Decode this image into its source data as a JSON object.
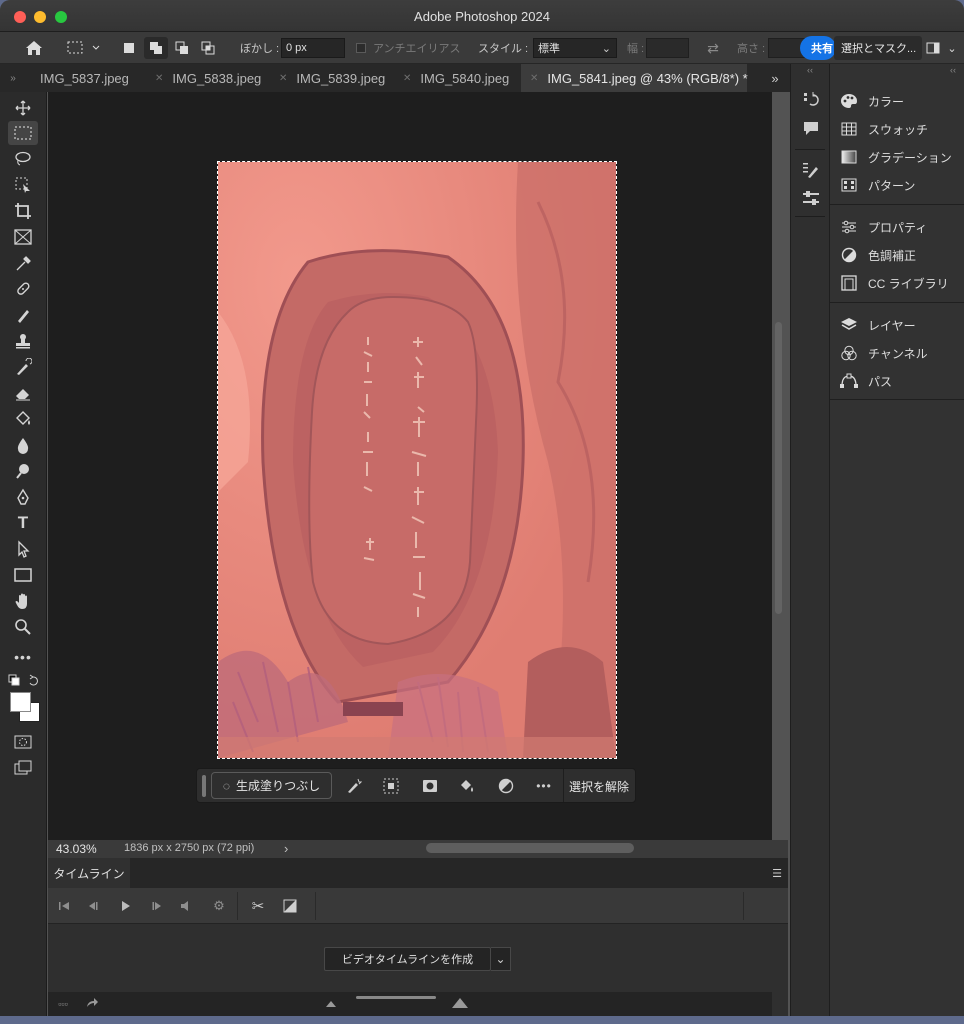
{
  "app": {
    "title": "Adobe Photoshop 2024"
  },
  "options_bar": {
    "feather_label": "ぼかし :",
    "feather_value": "0 px",
    "antialias_label": "アンチエイリアス",
    "style_label": "スタイル :",
    "style_value": "標準",
    "width_label": "幅 :",
    "height_label": "高さ :",
    "share_label": "共有",
    "select_mask_label": "選択とマスク..."
  },
  "tabs": [
    {
      "label": "IMG_5837.jpeg"
    },
    {
      "label": "IMG_5838.jpeg"
    },
    {
      "label": "IMG_5839.jpeg"
    },
    {
      "label": "IMG_5840.jpeg"
    },
    {
      "label": "IMG_5841.jpeg @ 43% (RGB/8*) *",
      "active": true
    }
  ],
  "tabbar_more": "»",
  "tools": [
    "move-tool",
    "rectangular-marquee-tool",
    "lasso-tool",
    "object-selection-tool",
    "crop-tool",
    "frame-tool",
    "eyedropper-tool",
    "spot-healing-brush-tool",
    "brush-tool",
    "clone-stamp-tool",
    "history-brush-tool",
    "eraser-tool",
    "paint-bucket-tool",
    "blur-tool",
    "dodge-tool",
    "pen-tool",
    "type-tool",
    "path-selection-tool",
    "rectangle-tool",
    "hand-tool",
    "zoom-tool",
    "more-tools"
  ],
  "contextual_bar": {
    "generative_fill": "生成塗りつぶし",
    "deselect": "選択を解除"
  },
  "status": {
    "zoom": "43.03%",
    "doc_info": "1836 px x 2750 px (72 ppi)",
    "arrow": "›"
  },
  "timeline": {
    "tab_label": "タイムライン",
    "create_button": "ビデオタイムラインを作成"
  },
  "panels": [
    {
      "label": "カラー",
      "icon": "palette-icon"
    },
    {
      "label": "スウォッチ",
      "icon": "swatches-grid-icon"
    },
    {
      "label": "グラデーション",
      "icon": "gradient-icon"
    },
    {
      "label": "パターン",
      "icon": "pattern-icon"
    },
    {
      "label": "プロパティ",
      "icon": "sliders-icon"
    },
    {
      "label": "色調補正",
      "icon": "half-circle-icon"
    },
    {
      "label": "CC ライブラリ",
      "icon": "library-icon"
    },
    {
      "label": "レイヤー",
      "icon": "layers-icon"
    },
    {
      "label": "チャンネル",
      "icon": "channels-icon"
    },
    {
      "label": "パス",
      "icon": "path-icon"
    }
  ],
  "colors": {
    "accent_blue": "#1473e6",
    "image_tint": "#e8857a",
    "ui_dark": "#1e1e1e"
  }
}
